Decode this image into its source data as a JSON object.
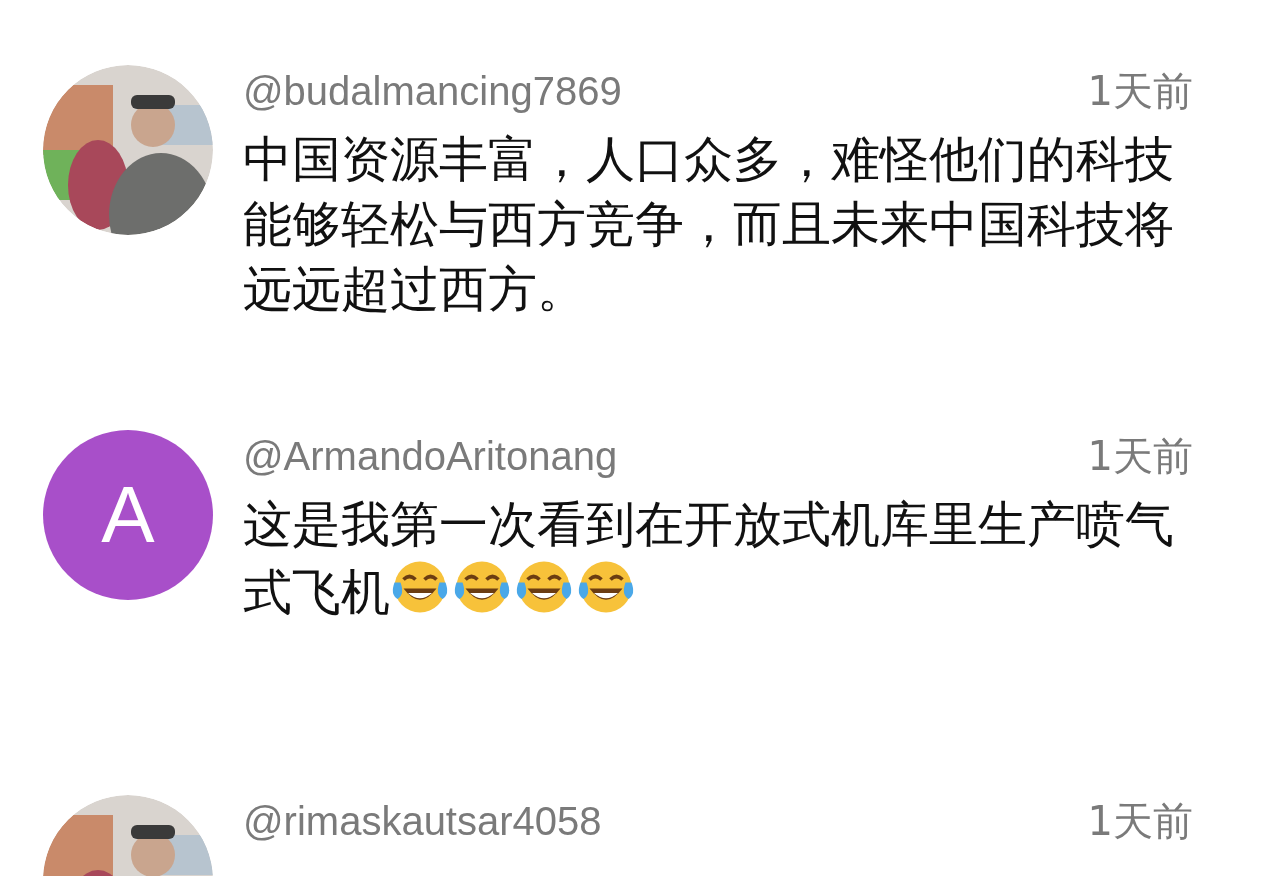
{
  "comments": [
    {
      "username": "@budalmancing7869",
      "time": "1天前",
      "text": "中国资源丰富，人口众多，难怪他们的科技能够轻松与西方竞争，而且未来中国科技将远远超过西方。"
    },
    {
      "avatar": {
        "kind": "letter",
        "letter": "A",
        "color": "#a84fc9"
      },
      "username": "@ArmandoAritonang",
      "time": "1天前",
      "text": "这是我第一次看到在开放式机库里生产喷气式飞机",
      "emojis": [
        {
          "kind": "tears-of-joy"
        },
        {
          "kind": "tears-of-joy"
        },
        {
          "kind": "tears-of-joy"
        },
        {
          "kind": "tears-of-joy"
        }
      ]
    },
    {
      "username": "@rimaskautsar4058",
      "time": "1天前"
    }
  ]
}
